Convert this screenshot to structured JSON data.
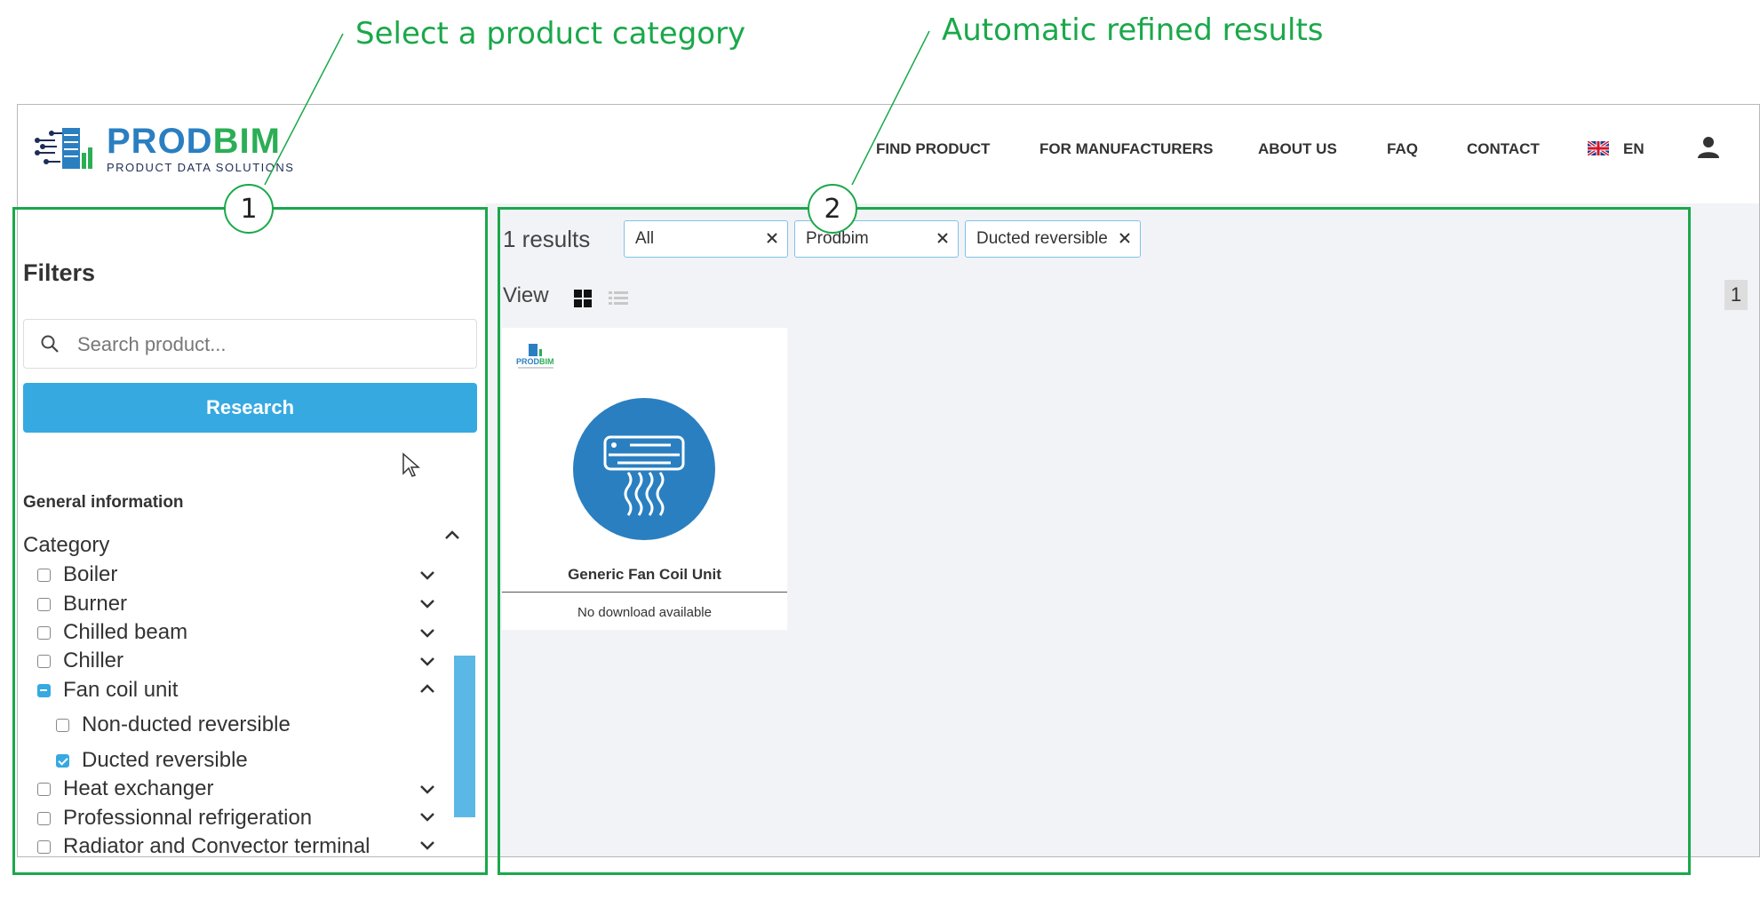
{
  "annotations": {
    "label_1": "Select a product category",
    "label_2": "Automatic refined results",
    "marker_1": "1",
    "marker_2": "2"
  },
  "header": {
    "logo_main_a": "PROD",
    "logo_main_b": "BIM",
    "logo_sub": "PRODUCT DATA SOLUTIONS",
    "nav": [
      "FIND PRODUCT",
      "FOR MANUFACTURERS",
      "ABOUT US",
      "FAQ",
      "CONTACT"
    ],
    "language": "EN",
    "user_icon": "user-icon"
  },
  "sidebar": {
    "title": "Filters",
    "search_placeholder": "Search product...",
    "research_label": "Research",
    "section": "General information",
    "category_label": "Category",
    "categories": [
      {
        "label": "Boiler",
        "state": "unchecked"
      },
      {
        "label": "Burner",
        "state": "unchecked"
      },
      {
        "label": "Chilled beam",
        "state": "unchecked"
      },
      {
        "label": "Chiller",
        "state": "unchecked"
      },
      {
        "label": "Fan coil unit",
        "state": "indeterminate",
        "expanded": true
      },
      {
        "label": "Non-ducted reversible",
        "state": "unchecked",
        "sub": true
      },
      {
        "label": "Ducted reversible",
        "state": "checked",
        "sub": true
      },
      {
        "label": "Heat exchanger",
        "state": "unchecked"
      },
      {
        "label": "Professionnal refrigeration",
        "state": "unchecked"
      },
      {
        "label": "Radiator and Convector terminal",
        "state": "unchecked"
      }
    ]
  },
  "results": {
    "count": "1 results",
    "chips": [
      "All",
      "Prodbim",
      "Ducted reversible"
    ],
    "view_label": "View",
    "page": "1",
    "card": {
      "title": "Generic Fan Coil Unit",
      "download": "No download available",
      "icon": "air-conditioner-icon",
      "logo_text": "PRODBIM"
    }
  },
  "colors": {
    "annotation": "#1aa84a",
    "accent": "#36a9e1",
    "product_icon_bg": "#2a7fc0"
  }
}
